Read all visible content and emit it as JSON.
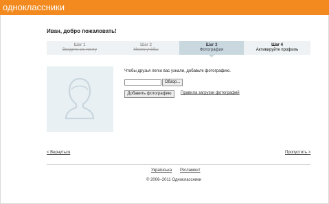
{
  "header": {
    "logo": "одноклассники"
  },
  "greeting": "Иван, добро пожаловать!",
  "steps": [
    {
      "title": "Шаг 1",
      "subtitle": "Введите эл. почту",
      "state": "done"
    },
    {
      "title": "Шаг 2",
      "subtitle": "Место учёбы",
      "state": "done"
    },
    {
      "title": "Шаг 3",
      "subtitle": "Фотография",
      "state": "active"
    },
    {
      "title": "Шаг 4",
      "subtitle": "Активируйте профиль",
      "state": "pending"
    }
  ],
  "photo": {
    "icon": "user-silhouette-icon"
  },
  "upload": {
    "hint": "Чтобы друзья легко вас узнали, добавьте фотографию.",
    "file_value": "",
    "browse_label": "Обзор...",
    "add_label": "Добавить фотографию",
    "rules_link": "Правила загрузки фотографий"
  },
  "nav": {
    "back": "< Вернуться",
    "skip": "Пропустить >"
  },
  "footer": {
    "language": "Українська",
    "rules": "Регламент",
    "copyright": "© 2006–2011 Одноклассники"
  },
  "colors": {
    "brand": "#f28a1f",
    "active_step": "#c9d8de",
    "step_bg": "#eef2f4"
  }
}
